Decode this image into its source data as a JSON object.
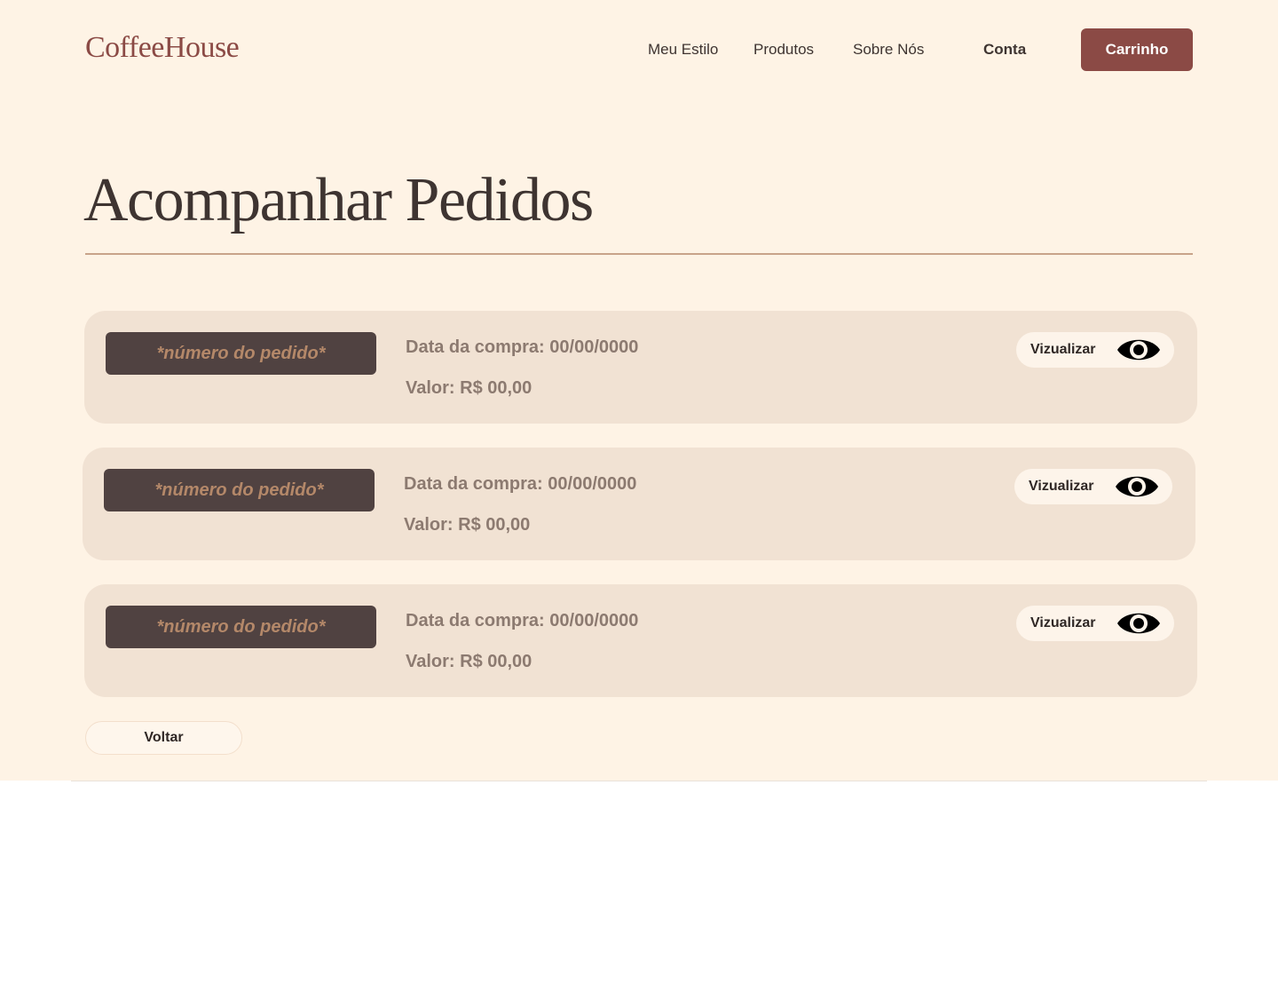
{
  "header": {
    "logo": "CoffeeHouse",
    "nav": {
      "meu_estilo": "Meu Estilo",
      "produtos": "Produtos",
      "sobre_nos": "Sobre Nós",
      "conta": "Conta"
    },
    "cart_label": "Carrinho"
  },
  "main": {
    "title": "Acompanhar Pedidos",
    "orders": [
      {
        "number": "*número do pedido*",
        "date": "Data da compra: 00/00/0000",
        "value": "Valor: R$ 00,00",
        "view_label": "Vizualizar",
        "view_icon": "eye-icon"
      },
      {
        "number": "*número do pedido*",
        "date": "Data da compra: 00/00/0000",
        "value": "Valor: R$ 00,00",
        "view_label": "Vizualizar",
        "view_icon": "eye-icon"
      },
      {
        "number": "*número do pedido*",
        "date": "Data da compra: 00/00/0000",
        "value": "Valor: R$ 00,00",
        "view_label": "Vizualizar",
        "view_icon": "eye-icon"
      }
    ],
    "back_label": "Voltar"
  },
  "colors": {
    "background": "#fef3e5",
    "brand": "#8b4a45",
    "card": "#f1e2d3",
    "order_tag": "#504241",
    "order_tag_text": "#b48869",
    "muted_text": "#8c7a70",
    "rule": "#c8a38a"
  }
}
